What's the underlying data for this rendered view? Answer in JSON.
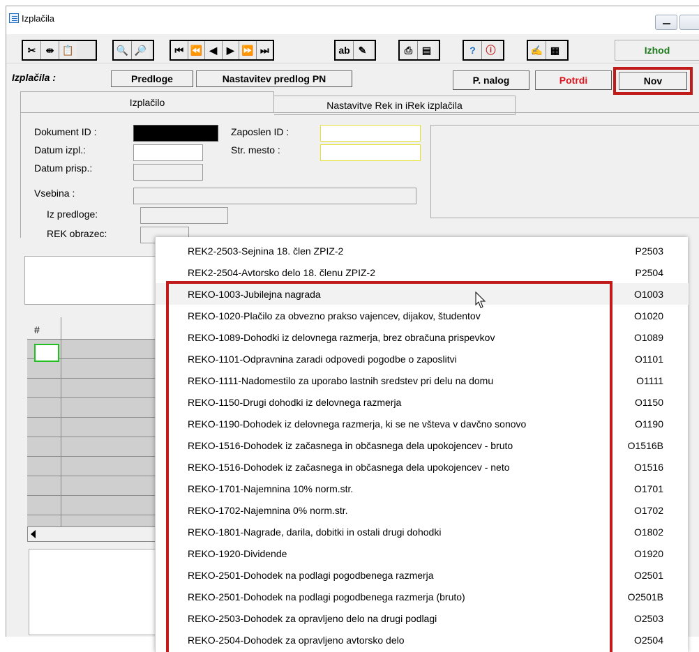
{
  "window": {
    "title": "Izplačila"
  },
  "toolbar": {
    "exit_label": "Izhod"
  },
  "actionbar": {
    "label": "Izplačila :",
    "predloge": "Predloge",
    "nastavitev": "Nastavitev predlog PN",
    "p_nalog": "P. nalog",
    "potrdi": "Potrdi",
    "nov": "Nov"
  },
  "tabs": [
    {
      "label": "Izplačilo"
    },
    {
      "label": "Nastavitve Rek in iRek izplačila"
    }
  ],
  "form": {
    "dokument_id": "Dokument ID :",
    "datum_izpl": "Datum izpl.:",
    "datum_prisp": "Datum prisp.:",
    "vsebina": "Vsebina :",
    "iz_predloge": "Iz predloge:",
    "rek_obrazec": "REK obrazec:",
    "zaposlen_id": "Zaposlen ID :",
    "str_mesto": "Str. mesto :"
  },
  "grid": {
    "hash": "#"
  },
  "dropdown": {
    "items": [
      {
        "name": "REK2-2503-Sejnina 18. člen ZPIZ-2",
        "code": "P2503"
      },
      {
        "name": "REK2-2504-Avtorsko delo 18. členu ZPIZ-2",
        "code": "P2504"
      },
      {
        "name": "REKO-1003-Jubilejna nagrada",
        "code": "O1003"
      },
      {
        "name": "REKO-1020-Plačilo za obvezno prakso vajencev, dijakov, študentov",
        "code": "O1020"
      },
      {
        "name": "REKO-1089-Dohodki iz delovnega razmerja, brez obračuna prispevkov",
        "code": "O1089"
      },
      {
        "name": "REKO-1101-Odpravnina zaradi odpovedi pogodbe o zaposlitvi",
        "code": "O1101"
      },
      {
        "name": "REKO-1111-Nadomestilo za uporabo lastnih sredstev pri delu na domu",
        "code": "O1111"
      },
      {
        "name": "REKO-1150-Drugi dohodki iz delovnega razmerja",
        "code": "O1150"
      },
      {
        "name": "REKO-1190-Dohodek iz delovnega razmerja, ki se ne všteva v davčno sonovo",
        "code": "O1190"
      },
      {
        "name": "REKO-1516-Dohodek iz začasnega in občasnega dela upokojencev - bruto",
        "code": "O1516B"
      },
      {
        "name": "REKO-1516-Dohodek iz začasnega in občasnega dela upokojencev - neto",
        "code": "O1516"
      },
      {
        "name": "REKO-1701-Najemnina 10% norm.str.",
        "code": "O1701"
      },
      {
        "name": "REKO-1702-Najemnina 0% norm.str.",
        "code": "O1702"
      },
      {
        "name": "REKO-1801-Nagrade, darila, dobitki in ostali drugi dohodki",
        "code": "O1802"
      },
      {
        "name": "REKO-1920-Dividende",
        "code": "O1920"
      },
      {
        "name": "REKO-2501-Dohodek na podlagi pogodbenega razmerja",
        "code": "O2501"
      },
      {
        "name": "REKO-2501-Dohodek na podlagi pogodbenega razmerja (bruto)",
        "code": "O2501B"
      },
      {
        "name": "REKO-2503-Dohodek za opravljeno delo na drugi podlagi",
        "code": "O2503"
      },
      {
        "name": "REKO-2504-Dohodek za opravljeno avtorsko delo",
        "code": "O2504"
      }
    ]
  },
  "colors": {
    "highlight": "#c01a1a",
    "confirm_red": "#e0141e",
    "exit_green": "#1c7a1c",
    "zaposlen_border": "#e6e22c"
  }
}
